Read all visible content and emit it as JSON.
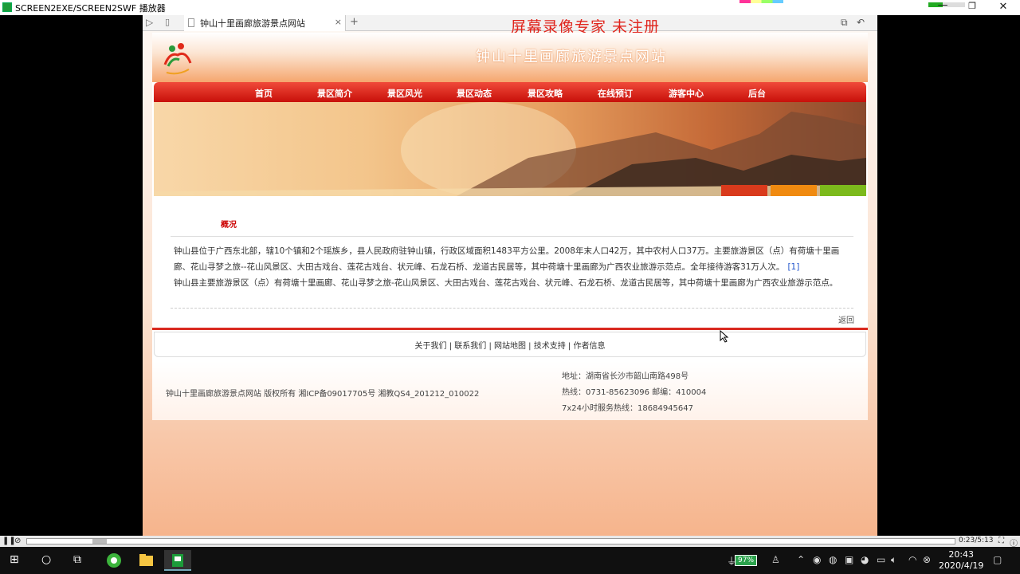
{
  "window": {
    "title": "SCREEN2EXE/SCREEN2SWF 播放器"
  },
  "browser": {
    "tab_title": "钟山十里画廊旅游景点网站",
    "tab_close": "×",
    "new_tab": "+",
    "watermark": "屏幕录像专家  未注册"
  },
  "site": {
    "title": "钟山十里画廊旅游景点网站",
    "nav": [
      "首页",
      "景区简介",
      "景区风光",
      "景区动态",
      "景区攻略",
      "在线预订",
      "游客中心",
      "后台"
    ],
    "section_title": "概况",
    "paragraph1": "钟山县位于广西东北部，辖10个镇和2个瑶族乡，县人民政府驻钟山镇，行政区域面积1483平方公里。2008年末人口42万，其中农村人口37万。主要旅游景区（点）有荷塘十里画廊、花山寻梦之旅--花山风景区、大田古戏台、莲花古戏台、状元峰、石龙石桥、龙道古民居等，其中荷塘十里画廊为广西农业旅游示范点。全年接待游客31万人次。",
    "paragraph1_ref": "[1]",
    "paragraph2": "钟山县主要旅游景区（点）有荷塘十里画廊、花山寻梦之旅-花山风景区、大田古戏台、莲花古戏台、状元峰、石龙石桥、龙道古民居等，其中荷塘十里画廊为广西农业旅游示范点。",
    "back": "返回",
    "footer_links": [
      "关于我们",
      "联系我们",
      "网站地图",
      "技术支持",
      "作者信息"
    ],
    "footer_sep": " | ",
    "copyright": "钟山十里画廊旅游景点网站 版权所有 湘ICP备09017705号 湘教QS4_201212_010022",
    "address": "地址：湖南省长沙市韶山南路498号",
    "phone": "热线：0731-85623096 邮编：410004",
    "hotline": "7x24小时服务热线：18684945647",
    "banner_tab_colors": [
      "#d93a1c",
      "#f08a10",
      "#7cba1c"
    ]
  },
  "player": {
    "time": "0:23/5:13",
    "progress": 0.07
  },
  "taskbar": {
    "battery": "97%",
    "time": "20:43",
    "date": "2020/4/19"
  },
  "colors": {
    "accent_red": "#d92a20",
    "nav_red": "#e0241c"
  }
}
